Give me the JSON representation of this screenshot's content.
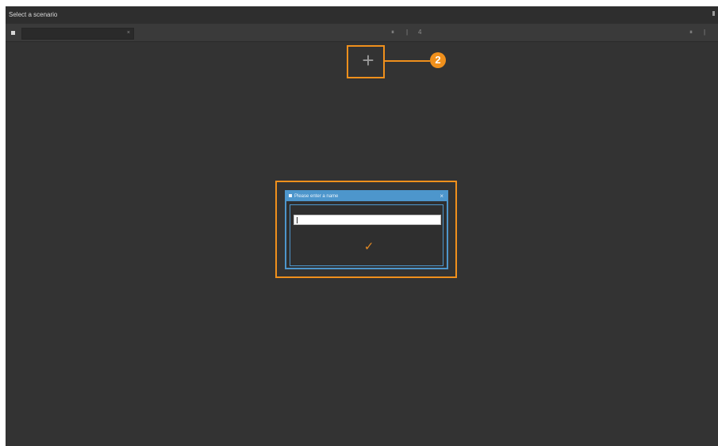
{
  "window": {
    "title": "Select a scenario"
  },
  "toolbar": {
    "scenario_select_value": "",
    "clear_glyph": "×",
    "center_glyphs": [
      "⏸",
      "|",
      "4"
    ],
    "right_glyphs": [
      "⏸",
      "|"
    ]
  },
  "add_button": {
    "icon": "plus-icon",
    "glyph": "+"
  },
  "callout": {
    "number": "2",
    "color": "#f0901c"
  },
  "dialog": {
    "title": "Please enter a name",
    "close_glyph": "×",
    "name_input_value": "",
    "confirm_icon": "checkmark-icon",
    "confirm_glyph": "✓"
  },
  "colors": {
    "background": "#333333",
    "accent_blue": "#4d96cc",
    "confirm_orange": "#e28a24"
  }
}
